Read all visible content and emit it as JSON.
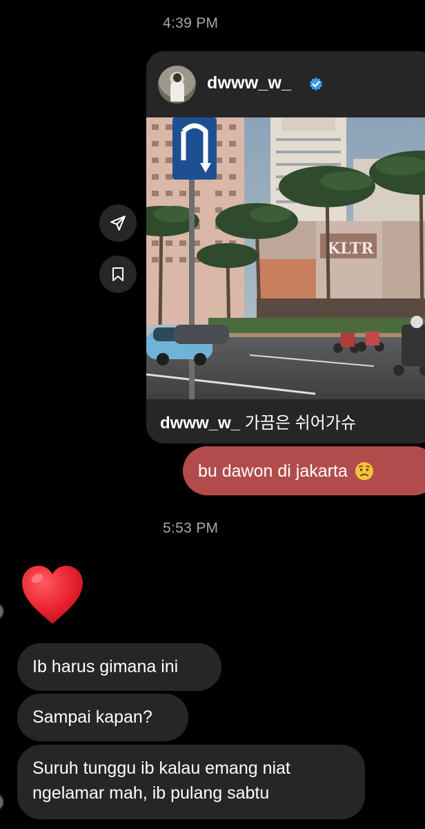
{
  "timestamps": [
    "4:39 PM",
    "5:53 PM"
  ],
  "shared_post": {
    "username": "dwww_w_",
    "verified": true,
    "caption_user": "dwww_w_",
    "caption_text": "가끔은 쉬어가슈",
    "image_sign_text": "KLTR"
  },
  "side_actions": {
    "share_icon": "send-icon",
    "save_icon": "bookmark-icon"
  },
  "outgoing_message": {
    "text": "bu dawon di jakarta",
    "emoji": "worried-face-emoji",
    "color": "#b24c4c"
  },
  "reaction": {
    "emoji": "red-heart-emoji",
    "color": "#e8222e"
  },
  "incoming_messages": [
    {
      "lines": [
        "Ib harus gimana ini"
      ]
    },
    {
      "lines": [
        "Sampai kapan?"
      ]
    },
    {
      "lines": [
        "Suruh tunggu ib kalau emang niat",
        "ngelamar mah, ib pulang sabtu"
      ]
    }
  ],
  "colors": {
    "background": "#000000",
    "bubble_incoming": "#262626",
    "timestamp": "#a8a8a8",
    "verified_blue": "#3897f0"
  }
}
